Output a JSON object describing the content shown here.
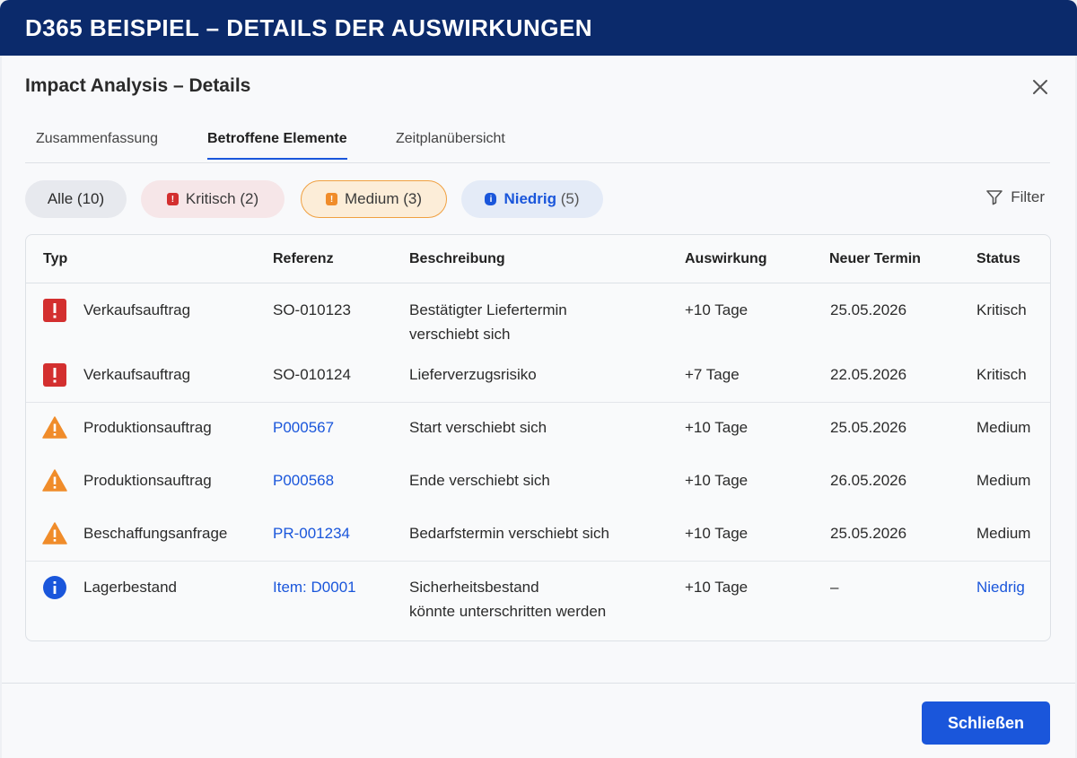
{
  "banner": {
    "title": "D365 BEISPIEL – DETAILS DER AUSWIRKUNGEN"
  },
  "dialog": {
    "title": "Impact Analysis – Details",
    "close_icon": "close-icon"
  },
  "tabs": [
    {
      "label": "Zusammenfassung",
      "active": false
    },
    {
      "label": "Betroffene Elemente",
      "active": true
    },
    {
      "label": "Zeitplanübersicht",
      "active": false
    }
  ],
  "filters": {
    "all": {
      "label": "Alle (10)"
    },
    "kritisch": {
      "label": "Kritisch (2)",
      "color": "#d32f2f"
    },
    "medium": {
      "label": "Medium (3)",
      "color": "#f08c2a",
      "selected": true
    },
    "niedrig": {
      "label": "Niedrig",
      "count": "(5)",
      "color": "#1a56db"
    },
    "filter_label": "Filter",
    "filter_icon": "filter-icon"
  },
  "table": {
    "headers": [
      "Typ",
      "Referenz",
      "Beschreibung",
      "Auswirkung",
      "Neuer Termin",
      "Status"
    ],
    "rows": [
      {
        "icon": "critical-icon",
        "typ": "Verkaufsauftrag",
        "ref": "SO-010123",
        "desc1": "Bestätigter Liefertermin",
        "desc2": "verschiebt sich",
        "impact": "+10 Tage",
        "date": "25.05.2026",
        "status": "Kritisch"
      },
      {
        "icon": "critical-icon",
        "typ": "Verkaufsauftrag",
        "ref": "SO-010124",
        "desc1": "Lieferverzugsrisiko",
        "desc2": "",
        "impact": "+7 Tage",
        "date": "22.05.2026",
        "status": "Kritisch"
      },
      {
        "icon": "warning-icon",
        "typ": "Produktionsauftrag",
        "ref": "P000567",
        "desc1": "Start verschiebt sich",
        "desc2": "",
        "impact": "+10 Tage",
        "date": "25.05.2026",
        "status": "Medium"
      },
      {
        "icon": "warning-icon",
        "typ": "Produktionsauftrag",
        "ref": "P000568",
        "desc1": "Ende verschiebt sich",
        "desc2": "",
        "impact": "+10 Tage",
        "date": "26.05.2026",
        "status": "Medium"
      },
      {
        "icon": "warning-icon",
        "typ": "Beschaffungsanfrage",
        "ref": "PR-001234",
        "desc1": "Bedarfstermin verschiebt sich",
        "desc2": "",
        "impact": "+10 Tage",
        "date": "25.05.2026",
        "status": "Medium"
      },
      {
        "icon": "info-icon",
        "typ": "Lagerbestand",
        "ref": "Item: D0001",
        "desc1": "Sicherheitsbestand",
        "desc2": "könnte unterschritten werden",
        "impact": "+10 Tage",
        "date": "–",
        "status": "Niedrig"
      }
    ]
  },
  "footer": {
    "close_label": "Schließen"
  }
}
